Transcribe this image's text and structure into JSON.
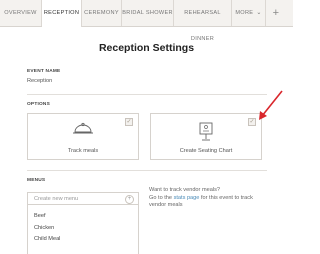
{
  "tabs": [
    {
      "label": "OVERVIEW"
    },
    {
      "label": "RECEPTION"
    },
    {
      "label": "CEREMONY"
    },
    {
      "label": "BRIDAL SHOWER"
    },
    {
      "label": "REHEARSAL DINNER"
    },
    {
      "label": "MORE"
    },
    {
      "label": "+"
    }
  ],
  "page": {
    "title": "Reception Settings"
  },
  "event_name": {
    "label": "EVENT NAME",
    "value": "Reception"
  },
  "options": {
    "label": "OPTIONS",
    "cards": [
      {
        "caption": "Track meals",
        "checked": true
      },
      {
        "caption": "Create Seating Chart",
        "checked": true
      }
    ]
  },
  "menus": {
    "label": "MENUS",
    "placeholder": "Create new menu",
    "items": [
      "Beef",
      "Chicken",
      "Child Meal"
    ]
  },
  "vendor": {
    "line1": "Want to track vendor meals?",
    "prefix": "Go to the",
    "link": "stats page",
    "suffix": "for this event to track vendor meals"
  },
  "colors": {
    "accent_arrow": "#d9262b",
    "link": "#4a8bb8"
  }
}
